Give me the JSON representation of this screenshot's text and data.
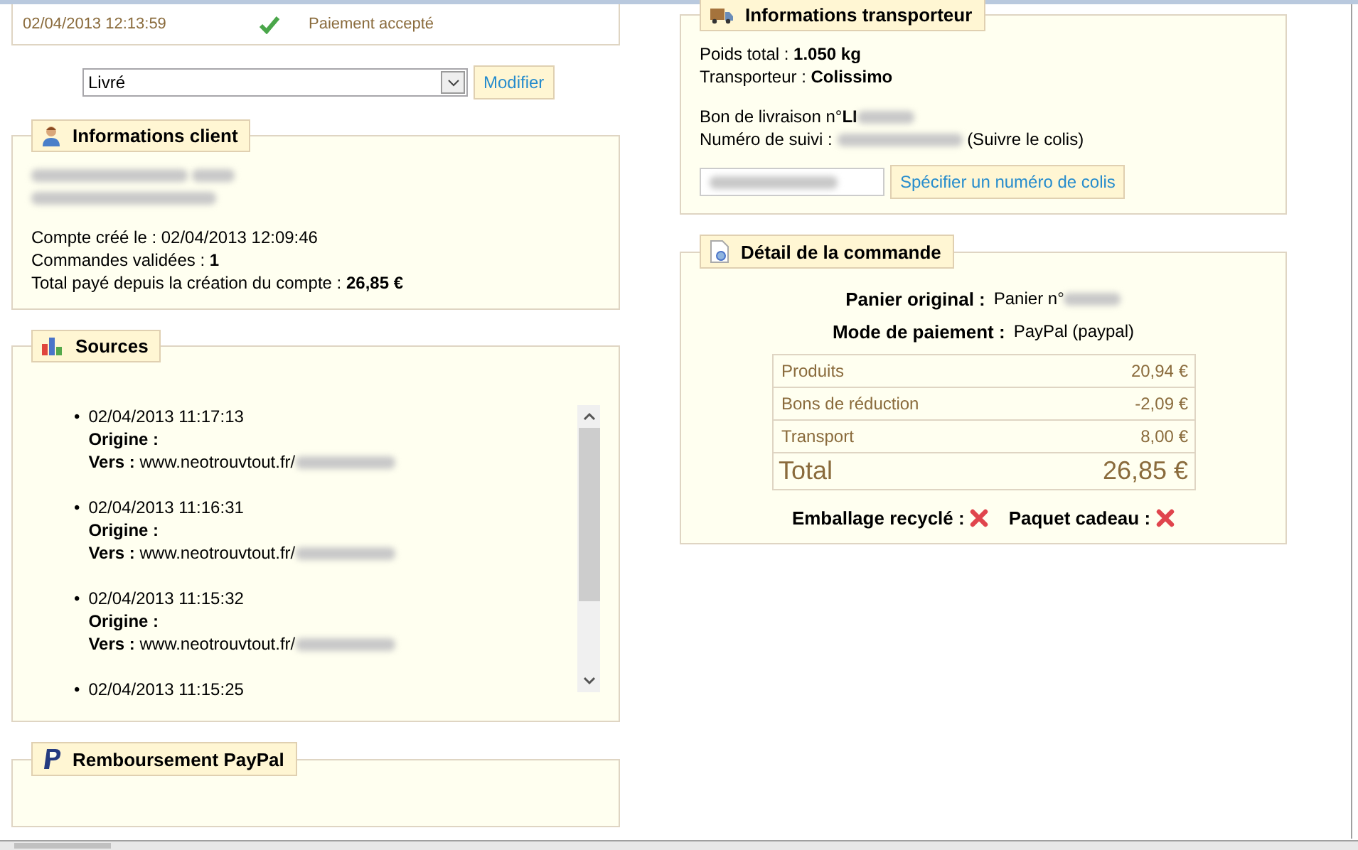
{
  "history": {
    "date": "02/04/2013 12:13:59",
    "status": "Paiement accepté"
  },
  "status_form": {
    "value": "Livré",
    "button": "Modifier"
  },
  "customer": {
    "title": "Informations client",
    "lines": [
      "Compte créé le : 02/04/2013 12:09:46",
      "Commandes validées : **1**",
      "Total payé depuis la création du compte : **26,85 €**"
    ]
  },
  "sources": {
    "title": "Sources",
    "items": [
      {
        "bullet": "•",
        "date": "02/04/2013 11:17:13",
        "origin_label": "Origine :",
        "to_label": "Vers :",
        "to_url": "www.neotrouvtout.fr/"
      },
      {
        "bullet": "•",
        "date": "02/04/2013 11:16:31",
        "origin_label": "Origine :",
        "to_label": "Vers :",
        "to_url": "www.neotrouvtout.fr/"
      },
      {
        "bullet": "•",
        "date": "02/04/2013 11:15:32",
        "origin_label": "Origine :",
        "to_label": "Vers :",
        "to_url": "www.neotrouvtout.fr/"
      },
      {
        "bullet": "•",
        "date": "02/04/2013 11:15:25"
      }
    ]
  },
  "refund": {
    "title": "Remboursement PayPal"
  },
  "carrier": {
    "title": "Informations transporteur",
    "lines": [
      "Poids total : **1.050 kg**",
      "Transporteur : **Colissimo**"
    ],
    "delivery_slip": "Bon de livraison n°**LI**",
    "tracking_label": "Numéro de suivi :",
    "tracking_link": "(Suivre le colis)",
    "button": "Spécifier un numéro de colis"
  },
  "order": {
    "title": "Détail de la commande",
    "cart_label": "Panier original :",
    "cart_value": "Panier n°",
    "payment_label": "Mode de paiement :",
    "payment_value": "PayPal (paypal)",
    "totals": [
      {
        "label": "Produits",
        "value": "20,94 €",
        "kind": "line"
      },
      {
        "label": "Bons de réduction",
        "value": "-2,09 €",
        "kind": "line"
      },
      {
        "label": "Transport",
        "value": "8,00 €",
        "kind": "line"
      },
      {
        "label": "Total",
        "value": "26,85 €",
        "kind": "total"
      }
    ],
    "options": [
      {
        "label": "Emballage recyclé :",
        "on": false
      },
      {
        "label": "Paquet cadeau :",
        "on": false
      }
    ]
  }
}
